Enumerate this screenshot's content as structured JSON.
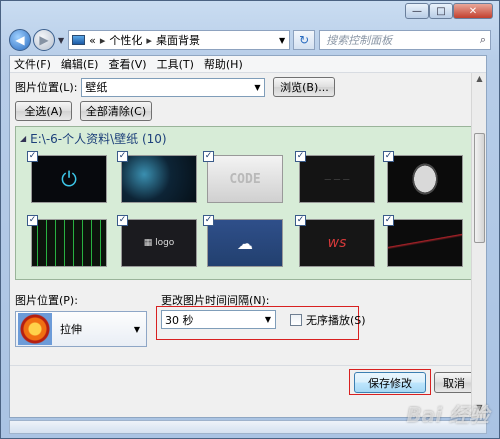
{
  "window": {
    "minimize": "—",
    "maximize": "□",
    "close": "✕"
  },
  "nav": {
    "back": "◀",
    "forward": "▶",
    "path_prefix": "«",
    "path_items": [
      "个性化",
      "桌面背景"
    ],
    "search_placeholder": "搜索控制面板",
    "search_icon": "⌕",
    "refresh_icon": "↻"
  },
  "menu": [
    "文件(F)",
    "编辑(E)",
    "查看(V)",
    "工具(T)",
    "帮助(H)"
  ],
  "location": {
    "label": "图片位置(L):",
    "value": "壁纸",
    "browse": "浏览(B)..."
  },
  "buttons": {
    "select_all": "全选(A)",
    "clear_all": "全部清除(C)",
    "save": "保存修改",
    "cancel": "取消"
  },
  "gallery": {
    "header": "E:\\-6-个人资料\\壁纸 (10)",
    "thumbnails": [
      {
        "name": "power-icon-wallpaper",
        "checked": true,
        "text": "⏻"
      },
      {
        "name": "neon-circuit-wallpaper",
        "checked": true,
        "text": ""
      },
      {
        "name": "code-wallpaper",
        "checked": true,
        "text": "CODE"
      },
      {
        "name": "dark-text-wallpaper",
        "checked": true,
        "text": "— — —"
      },
      {
        "name": "mask-wallpaper",
        "checked": true,
        "text": ""
      },
      {
        "name": "matrix-wallpaper",
        "checked": true,
        "text": ""
      },
      {
        "name": "windows-logo-wallpaper",
        "checked": true,
        "text": "▦ logo"
      },
      {
        "name": "cloud-wallpaper",
        "checked": true,
        "text": "☁"
      },
      {
        "name": "red-logo-wallpaper",
        "checked": true,
        "text": "ws"
      },
      {
        "name": "red-line-wallpaper",
        "checked": true,
        "text": ""
      }
    ]
  },
  "position": {
    "label": "图片位置(P):",
    "value": "拉伸"
  },
  "interval": {
    "label": "更改图片时间间隔(N):",
    "value": "30 秒",
    "shuffle_label": "无序播放(S)"
  },
  "watermark": "Bai 经验",
  "colors": {
    "highlight_red": "#d82020",
    "gallery_bg": "#d7ecd7",
    "header_blue": "#1c3f7a"
  }
}
